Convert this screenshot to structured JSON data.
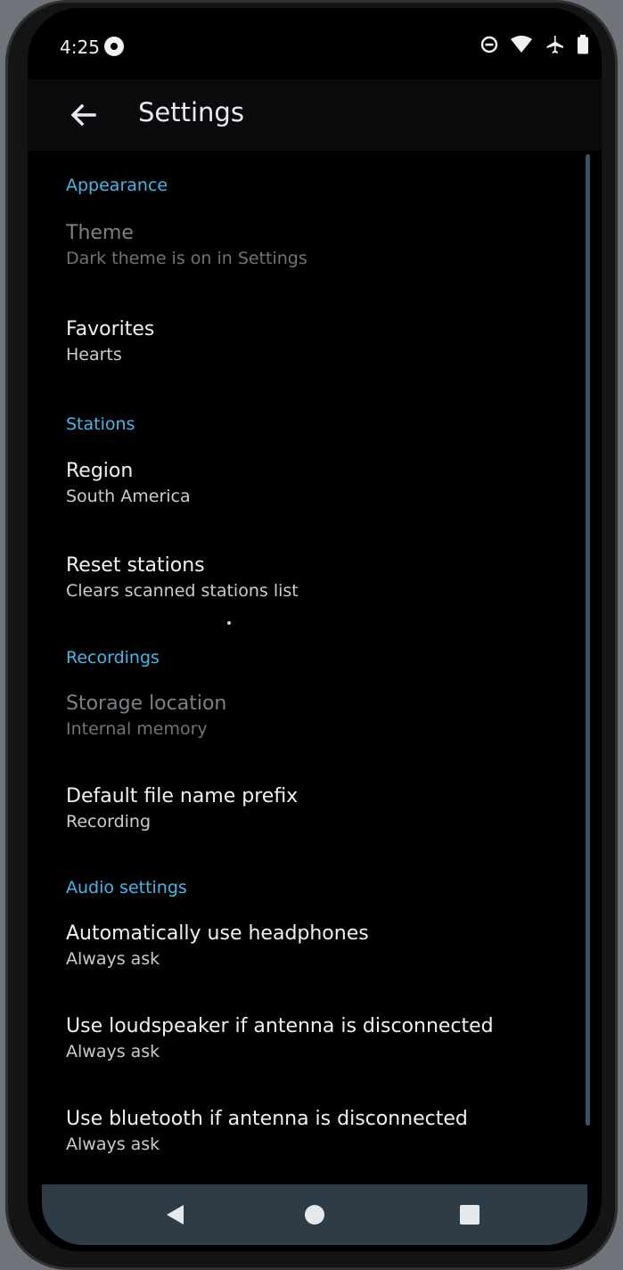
{
  "status_bar": {
    "time": "4:25",
    "icons": [
      "notification-dot-icon",
      "do-not-disturb-icon",
      "wifi-icon",
      "airplane-icon",
      "battery-icon"
    ]
  },
  "toolbar": {
    "back_icon": "arrow-back-icon",
    "title": "Settings"
  },
  "sections": {
    "appearance": {
      "header": "Appearance",
      "theme": {
        "title": "Theme",
        "summary": "Dark theme is on in Settings"
      },
      "favorites": {
        "title": "Favorites",
        "summary": "Hearts"
      }
    },
    "stations": {
      "header": "Stations",
      "region": {
        "title": "Region",
        "summary": "South America"
      },
      "reset": {
        "title": "Reset stations",
        "summary": "Clears scanned stations list"
      }
    },
    "recordings": {
      "header": "Recordings",
      "storage": {
        "title": "Storage location",
        "summary": "Internal memory"
      },
      "prefix": {
        "title": "Default file name prefix",
        "summary": "Recording"
      }
    },
    "audio": {
      "header": "Audio settings",
      "headphones": {
        "title": "Automatically use headphones",
        "summary": "Always ask"
      },
      "loudspeaker": {
        "title": "Use loudspeaker if antenna is disconnected",
        "summary": "Always ask"
      },
      "bluetooth": {
        "title": "Use bluetooth if antenna is disconnected",
        "summary": "Always ask"
      }
    }
  },
  "nav_bar": {
    "back": "nav-back-icon",
    "home": "nav-home-icon",
    "recents": "nav-recents-icon"
  },
  "colors": {
    "accent": "#44b8e8",
    "background": "#000000",
    "toolbar": "#0b0b0d",
    "nav_bar": "#2e3c47",
    "text_primary": "#eef2f6",
    "text_disabled": "#7b8186"
  }
}
